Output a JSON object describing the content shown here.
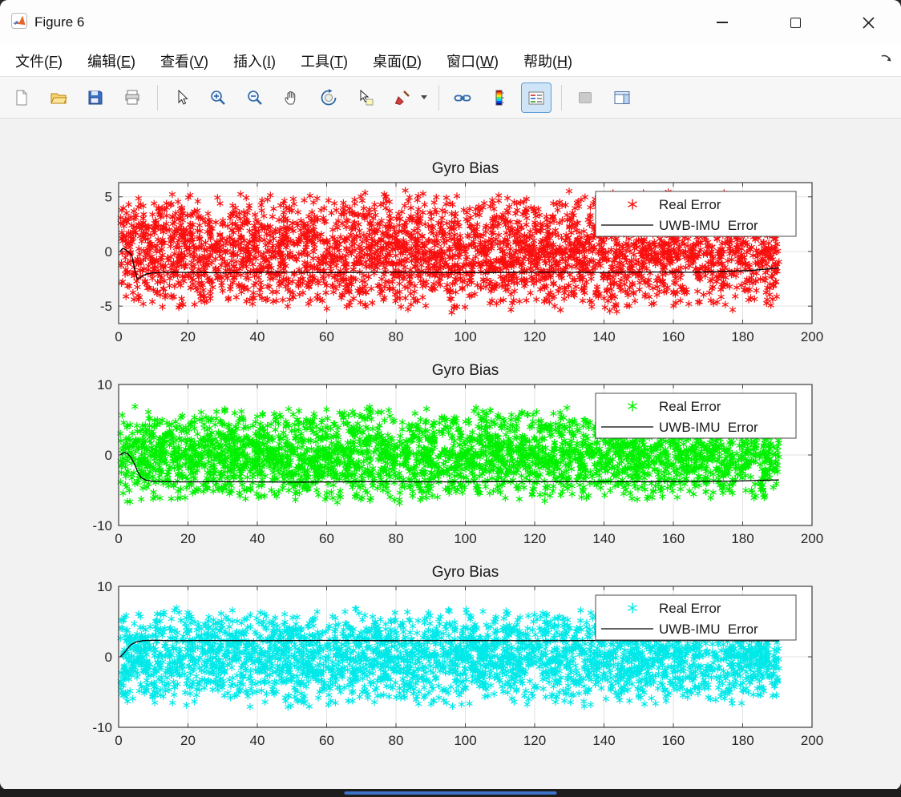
{
  "window": {
    "title": "Figure 6",
    "controls": [
      "minimize",
      "maximize",
      "close"
    ]
  },
  "menu": {
    "items": [
      {
        "pre": "文件(",
        "key": "F",
        "post": ")"
      },
      {
        "pre": "编辑(",
        "key": "E",
        "post": ")"
      },
      {
        "pre": "查看(",
        "key": "V",
        "post": ")"
      },
      {
        "pre": "插入(",
        "key": "I",
        "post": ")"
      },
      {
        "pre": "工具(",
        "key": "T",
        "post": ")"
      },
      {
        "pre": "桌面(",
        "key": "D",
        "post": ")"
      },
      {
        "pre": "窗口(",
        "key": "W",
        "post": ")"
      },
      {
        "pre": "帮助(",
        "key": "H",
        "post": ")"
      }
    ]
  },
  "toolbar": {
    "icons": [
      "new-figure",
      "open-file",
      "save",
      "print",
      "edit-plot",
      "zoom-in",
      "zoom-out",
      "pan",
      "rotate-3d",
      "data-cursor",
      "brush",
      "link-plot",
      "insert-colorbar",
      "insert-legend",
      "hide-plot-tools",
      "show-plot-tools"
    ],
    "active_icon": "insert-legend"
  },
  "chart_data": [
    {
      "type": "scatter",
      "title": "Gyro Bias",
      "xlim": [
        0,
        200
      ],
      "ylim": [
        -6.6,
        6.3
      ],
      "xticks": [
        0,
        20,
        40,
        60,
        80,
        100,
        120,
        140,
        160,
        180,
        200
      ],
      "yticks": [
        -5,
        0,
        5
      ],
      "grid": true,
      "legend": {
        "position": "top-right",
        "entries": [
          "Real Error",
          "UWB-IMU  Error"
        ]
      },
      "scatter": {
        "name": "Real Error",
        "marker": "*",
        "color": "#fa0f0f",
        "x_range": [
          0.5,
          190.5
        ],
        "band_amplitude": 5.7,
        "n_points": 3200,
        "seed": 101
      },
      "line": {
        "name": "UWB-IMU  Error",
        "color": "#000000",
        "points": [
          [
            0.5,
            0.05
          ],
          [
            1.2,
            0.3
          ],
          [
            2,
            0.15
          ],
          [
            3,
            -0.1
          ],
          [
            3.8,
            -0.35
          ],
          [
            4.6,
            -1.6
          ],
          [
            5.4,
            -2.55
          ],
          [
            6.5,
            -2.35
          ],
          [
            8,
            -2.05
          ],
          [
            10,
            -1.95
          ],
          [
            14,
            -1.9
          ],
          [
            20,
            -1.92
          ],
          [
            30,
            -1.95
          ],
          [
            45,
            -1.9
          ],
          [
            60,
            -1.93
          ],
          [
            80,
            -1.9
          ],
          [
            100,
            -1.93
          ],
          [
            120,
            -1.9
          ],
          [
            140,
            -1.92
          ],
          [
            155,
            -1.88
          ],
          [
            165,
            -1.9
          ],
          [
            175,
            -1.82
          ],
          [
            182,
            -1.75
          ],
          [
            187,
            -1.6
          ],
          [
            190.5,
            -1.5
          ]
        ]
      }
    },
    {
      "type": "scatter",
      "title": "Gyro Bias",
      "xlim": [
        0,
        200
      ],
      "ylim": [
        -10,
        10
      ],
      "xticks": [
        0,
        20,
        40,
        60,
        80,
        100,
        120,
        140,
        160,
        180,
        200
      ],
      "yticks": [
        -10,
        0,
        10
      ],
      "grid": true,
      "legend": {
        "position": "top-right",
        "entries": [
          "Real Error",
          "UWB-IMU  Error"
        ]
      },
      "scatter": {
        "name": "Real Error",
        "marker": "*",
        "color": "#00f000",
        "x_range": [
          0.5,
          190.5
        ],
        "band_amplitude": 7.0,
        "n_points": 3200,
        "seed": 202
      },
      "line": {
        "name": "UWB-IMU  Error",
        "color": "#000000",
        "points": [
          [
            0.5,
            0.05
          ],
          [
            1.5,
            0.35
          ],
          [
            2.5,
            0.2
          ],
          [
            3.5,
            -0.3
          ],
          [
            4.5,
            -1.2
          ],
          [
            5.5,
            -2.4
          ],
          [
            6.5,
            -3.2
          ],
          [
            8,
            -3.6
          ],
          [
            10,
            -3.75
          ],
          [
            14,
            -3.8
          ],
          [
            20,
            -3.82
          ],
          [
            30,
            -3.8
          ],
          [
            50,
            -3.85
          ],
          [
            70,
            -3.8
          ],
          [
            90,
            -3.82
          ],
          [
            110,
            -3.78
          ],
          [
            130,
            -3.8
          ],
          [
            150,
            -3.78
          ],
          [
            165,
            -3.75
          ],
          [
            178,
            -3.7
          ],
          [
            185,
            -3.6
          ],
          [
            190.5,
            -3.55
          ]
        ]
      }
    },
    {
      "type": "scatter",
      "title": "Gyro Bias",
      "xlim": [
        0,
        200
      ],
      "ylim": [
        -10,
        10
      ],
      "xticks": [
        0,
        20,
        40,
        60,
        80,
        100,
        120,
        140,
        160,
        180,
        200
      ],
      "yticks": [
        -10,
        0,
        10
      ],
      "grid": true,
      "legend": {
        "position": "top-right",
        "entries": [
          "Real Error",
          "UWB-IMU  Error"
        ]
      },
      "scatter": {
        "name": "Real Error",
        "marker": "*",
        "color": "#00e8e8",
        "x_range": [
          0.5,
          190.5
        ],
        "band_amplitude": 7.2,
        "n_points": 3200,
        "seed": 303
      },
      "line": {
        "name": "UWB-IMU  Error",
        "color": "#000000",
        "points": [
          [
            0.5,
            0.05
          ],
          [
            1.5,
            0.5
          ],
          [
            2.5,
            1.1
          ],
          [
            3.5,
            1.7
          ],
          [
            5,
            2.1
          ],
          [
            7,
            2.3
          ],
          [
            10,
            2.35
          ],
          [
            15,
            2.3
          ],
          [
            25,
            2.32
          ],
          [
            40,
            2.3
          ],
          [
            60,
            2.33
          ],
          [
            80,
            2.3
          ],
          [
            100,
            2.32
          ],
          [
            120,
            2.3
          ],
          [
            140,
            2.32
          ],
          [
            155,
            2.3
          ],
          [
            170,
            2.32
          ],
          [
            180,
            2.3
          ],
          [
            190.5,
            2.3
          ]
        ]
      }
    }
  ]
}
